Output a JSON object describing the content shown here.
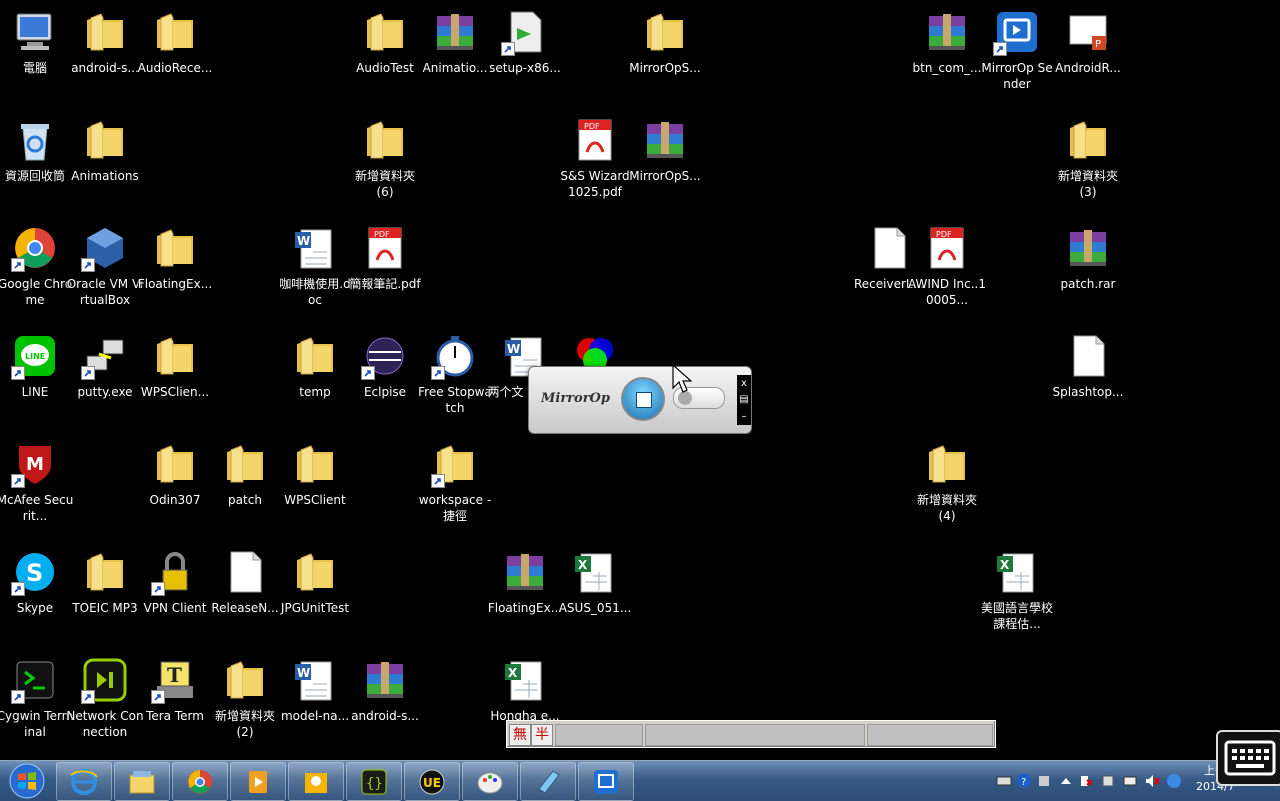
{
  "desktop": {
    "icons": [
      {
        "label": "電腦",
        "icon": "computer-icon"
      },
      {
        "label": "android-s...",
        "icon": "folder-icon"
      },
      {
        "label": "AudioRece...",
        "icon": "folder-icon"
      },
      {
        "label": "AudioTest",
        "icon": "folder-icon"
      },
      {
        "label": "Animatio...",
        "icon": "rar-archive-icon"
      },
      {
        "label": "setup-x86...",
        "icon": "setup-icon"
      },
      {
        "label": "MirrorOpS...",
        "icon": "folder-icon"
      },
      {
        "label": "btn_com_...",
        "icon": "rar-archive-icon"
      },
      {
        "label": "MirrorOp Sender",
        "icon": "mirrorop-icon"
      },
      {
        "label": "AndroidR...",
        "icon": "powerpoint-doc-icon"
      },
      {
        "label": "資源回收筒",
        "icon": "recycle-bin-icon"
      },
      {
        "label": "Animations",
        "icon": "folder-icon"
      },
      {
        "label": "新增資料夾 (6)",
        "icon": "folder-icon"
      },
      {
        "label": "S&S Wizard 1025.pdf",
        "icon": "pdf-icon"
      },
      {
        "label": "MirrorOpS...",
        "icon": "rar-archive-icon"
      },
      {
        "label": "新增資料夾 (3)",
        "icon": "folder-icon"
      },
      {
        "label": "Google Chrome",
        "icon": "chrome-icon"
      },
      {
        "label": "Oracle VM VirtualBox",
        "icon": "virtualbox-icon"
      },
      {
        "label": "FloatingEx...",
        "icon": "folder-icon"
      },
      {
        "label": "咖啡機使用.doc",
        "icon": "word-doc-icon"
      },
      {
        "label": "簡報筆記.pdf",
        "icon": "pdf-icon"
      },
      {
        "label": "ReceiverL...",
        "icon": "text-file-icon"
      },
      {
        "label": "AWIND Inc..10005...",
        "icon": "pdf-icon"
      },
      {
        "label": "patch.rar",
        "icon": "rar-archive-icon"
      },
      {
        "label": "LINE",
        "icon": "line-icon"
      },
      {
        "label": "putty.exe",
        "icon": "putty-icon"
      },
      {
        "label": "WPSClien...",
        "icon": "folder-icon"
      },
      {
        "label": "temp",
        "icon": "folder-icon"
      },
      {
        "label": "Eclpise",
        "icon": "eclipse-icon"
      },
      {
        "label": "Free Stopwatch",
        "icon": "stopwatch-icon"
      },
      {
        "label": "两个文 个是IS",
        "icon": "word-doc-icon"
      },
      {
        "label": "",
        "icon": "color-wheel-icon"
      },
      {
        "label": "Splashtop...",
        "icon": "text-file-icon"
      },
      {
        "label": "McAfee Securit...",
        "icon": "mcafee-icon"
      },
      {
        "label": "Odin307",
        "icon": "folder-icon"
      },
      {
        "label": "patch",
        "icon": "folder-icon"
      },
      {
        "label": "WPSClient",
        "icon": "folder-icon"
      },
      {
        "label": "workspace - 捷徑",
        "icon": "folder-icon"
      },
      {
        "label": "新增資料夾 (4)",
        "icon": "folder-icon"
      },
      {
        "label": "Skype",
        "icon": "skype-icon"
      },
      {
        "label": "TOEIC MP3",
        "icon": "folder-icon"
      },
      {
        "label": "VPN Client",
        "icon": "vpn-lock-icon"
      },
      {
        "label": "ReleaseN...",
        "icon": "text-file-icon"
      },
      {
        "label": "JPGUnitTest",
        "icon": "folder-icon"
      },
      {
        "label": "FloatingEx...",
        "icon": "rar-archive-icon"
      },
      {
        "label": "ASUS_051...",
        "icon": "excel-doc-icon"
      },
      {
        "label": "美國語言學校課程估...",
        "icon": "excel-doc-icon"
      },
      {
        "label": "Cygwin Terminal",
        "icon": "cygwin-icon"
      },
      {
        "label": "Network Connection",
        "icon": "network-connection-icon"
      },
      {
        "label": "Tera Term",
        "icon": "teraterm-icon"
      },
      {
        "label": "新增資料夾 (2)",
        "icon": "folder-icon"
      },
      {
        "label": "model-na...",
        "icon": "word-doc-icon"
      },
      {
        "label": "android-s...",
        "icon": "rar-archive-icon"
      },
      {
        "label": "Hongha e...",
        "icon": "excel-doc-icon"
      }
    ]
  },
  "mirrorop_widget": {
    "brand": "MirrorOp",
    "close_label": "x",
    "menu_label": "▤",
    "minimize_label": "–"
  },
  "ime_bar": {
    "mode1": "無",
    "mode2": "半"
  },
  "taskbar": {
    "apps": [
      "ie-icon",
      "explorer-icon",
      "chrome-icon",
      "media-icon",
      "outlook-notes-icon",
      "json-icon",
      "ultraedit-icon",
      "paint-icon",
      "notepad-icon",
      "mirrorop-icon"
    ]
  },
  "tray": {
    "clock_line1": "上午",
    "clock_line2": "2014/7"
  },
  "colors": {
    "taskbar": "#365a86",
    "folder": "#f2d46b",
    "rar_purple": "#7b3fa0"
  }
}
